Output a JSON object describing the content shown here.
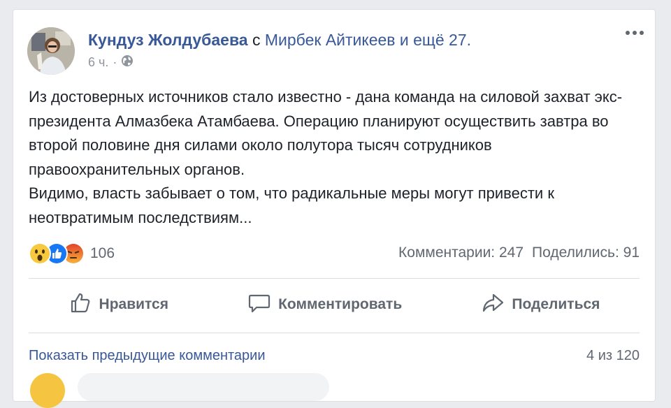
{
  "post": {
    "author": "Кундуз Жолдубаева",
    "with_text": " с ",
    "tagged": "Мирбек Айтикеев и ещё 27.",
    "time": "6 ч.",
    "separator": "·",
    "paragraphs": [
      "Из достоверных источников стало известно - дана команда на силовой захват экс-президента Алмазбека Атамбаева. Операцию планируют осуществить завтра во второй половине дня силами около полутора тысяч сотрудников правоохранительных органов.",
      "Видимо, власть забывает о том, что радикальные меры могут привести к неотвратимым последствиям..."
    ]
  },
  "reactions": {
    "icons": [
      "wow-reaction-icon",
      "like-reaction-icon",
      "angry-reaction-icon"
    ],
    "count": "106"
  },
  "stats": {
    "comments": "Комментарии: 247",
    "shares": "Поделились: 91"
  },
  "actions": {
    "like": "Нравится",
    "comment": "Комментировать",
    "share": "Поделиться"
  },
  "comments": {
    "show_previous": "Показать предыдущие комментарии",
    "count": "4 из 120"
  },
  "colors": {
    "link": "#385898",
    "secondary": "#606770",
    "like_blue": "#1877f2",
    "angry": "#f05d28",
    "wow": "#f7c93e"
  }
}
